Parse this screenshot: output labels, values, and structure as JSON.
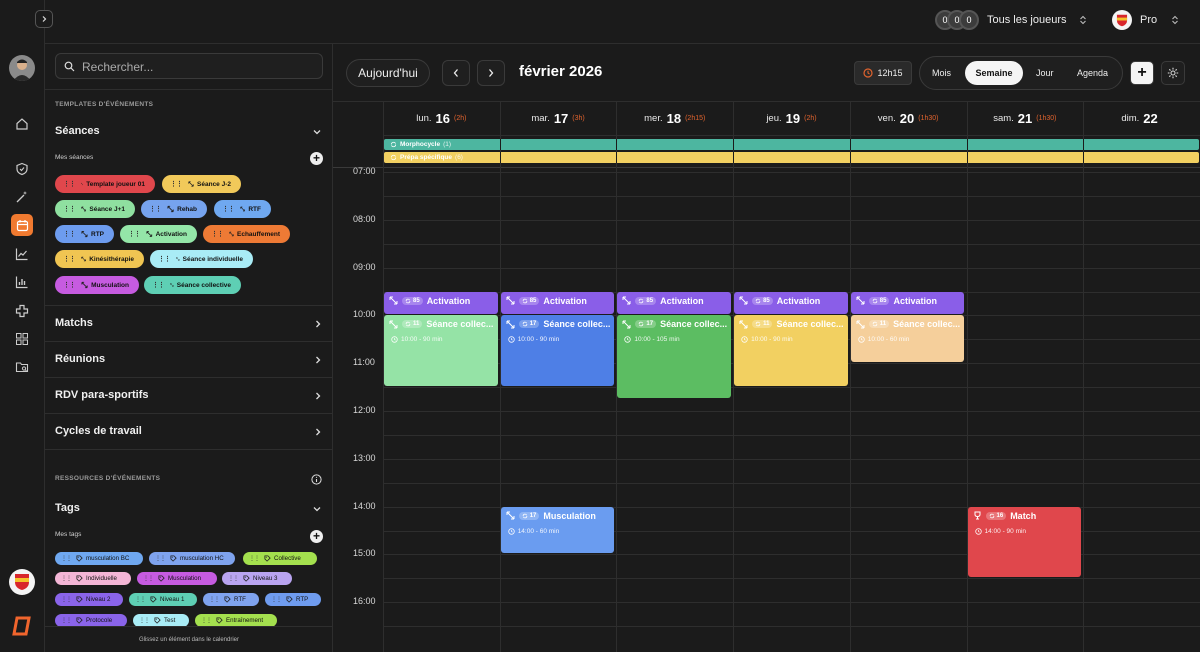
{
  "topbar": {
    "players_label": "Tous les joueurs",
    "player_avatars": [
      "0",
      "0",
      "0"
    ],
    "team_label": "Pro"
  },
  "sidebar": {
    "search_placeholder": "Rechercher...",
    "templates_heading": "TEMPLATES D'ÉVÉNEMENTS",
    "seances": {
      "title": "Séances",
      "subtitle": "Mes séances",
      "chips": [
        {
          "label": "Template joueur 01",
          "color": "#e0474c"
        },
        {
          "label": "Séance J-2",
          "color": "#f1c95a"
        },
        {
          "label": "Séance J+1",
          "color": "#8fe0a0"
        },
        {
          "label": "Rehab",
          "color": "#76a3ee"
        },
        {
          "label": "RTF",
          "color": "#6fa8f0"
        },
        {
          "label": "RTP",
          "color": "#6d9cef"
        },
        {
          "label": "Activation",
          "color": "#94e6a8"
        },
        {
          "label": "Echauffement",
          "color": "#ee7a35"
        },
        {
          "label": "Kinésithérapie",
          "color": "#f0c552"
        },
        {
          "label": "Séance individuelle",
          "color": "#a9ecf6"
        },
        {
          "label": "Musculation",
          "color": "#c65be0"
        },
        {
          "label": "Séance collective",
          "color": "#5ecfb4"
        }
      ]
    },
    "sections": [
      "Matchs",
      "Réunions",
      "RDV para-sportifs",
      "Cycles de travail"
    ],
    "resources_heading": "RESSOURCES D'ÉVÉNEMENTS",
    "tags": {
      "title": "Tags",
      "subtitle": "Mes tags",
      "items": [
        {
          "label": "musculation BC",
          "color": "#6fa8f0"
        },
        {
          "label": "musculation HC",
          "color": "#7fa3ee"
        },
        {
          "label": "Collective",
          "color": "#a4e04e"
        },
        {
          "label": "Individuelle",
          "color": "#f4b6d6"
        },
        {
          "label": "Musculation",
          "color": "#c65be0"
        },
        {
          "label": "Niveau 3",
          "color": "#b9a4f0"
        },
        {
          "label": "Niveau 2",
          "color": "#8a64ea"
        },
        {
          "label": "Niveau 1",
          "color": "#5ecfb4"
        },
        {
          "label": "RTF",
          "color": "#7fa3ee"
        },
        {
          "label": "RTP",
          "color": "#6f9cef"
        },
        {
          "label": "Protocole",
          "color": "#8a64ea"
        },
        {
          "label": "Test",
          "color": "#a9ecf6"
        },
        {
          "label": "Entraînement",
          "color": "#a4e04e"
        }
      ]
    },
    "footer_hint": "Glissez un élément dans le calendrier"
  },
  "main": {
    "today_button": "Aujourd'hui",
    "month_title": "février 2026",
    "duration_badge": "12h15",
    "views": [
      "Mois",
      "Semaine",
      "Jour",
      "Agenda"
    ],
    "active_view": "Semaine",
    "days": [
      {
        "name": "lun.",
        "num": "16",
        "dur": "(2h)"
      },
      {
        "name": "mar.",
        "num": "17",
        "dur": "(3h)"
      },
      {
        "name": "mer.",
        "num": "18",
        "dur": "(2h15)"
      },
      {
        "name": "jeu.",
        "num": "19",
        "dur": "(2h)"
      },
      {
        "name": "ven.",
        "num": "20",
        "dur": "(1h30)"
      },
      {
        "name": "sam.",
        "num": "21",
        "dur": "(1h30)"
      },
      {
        "name": "dim.",
        "num": "22",
        "dur": ""
      }
    ],
    "allday": [
      {
        "label": "Morphocycle",
        "count": "(1)",
        "color": "#4db6a0"
      },
      {
        "label": "Prépa spécifique",
        "count": "(6)",
        "color": "#f2d061"
      }
    ],
    "hours": [
      "07:00",
      "08:00",
      "09:00",
      "10:00",
      "11:00",
      "12:00",
      "13:00",
      "14:00",
      "15:00",
      "16:00"
    ],
    "events": [
      {
        "day": 0,
        "start": 9.5,
        "end": 10.0,
        "title": "Activation",
        "count": "85",
        "sub": "",
        "color": "#8a5ee8"
      },
      {
        "day": 1,
        "start": 9.5,
        "end": 10.0,
        "title": "Activation",
        "count": "85",
        "sub": "",
        "color": "#8a5ee8"
      },
      {
        "day": 2,
        "start": 9.5,
        "end": 10.0,
        "title": "Activation",
        "count": "85",
        "sub": "",
        "color": "#8a5ee8"
      },
      {
        "day": 3,
        "start": 9.5,
        "end": 10.0,
        "title": "Activation",
        "count": "85",
        "sub": "",
        "color": "#8a5ee8"
      },
      {
        "day": 4,
        "start": 9.5,
        "end": 10.0,
        "title": "Activation",
        "count": "85",
        "sub": "",
        "color": "#8a5ee8"
      },
      {
        "day": 0,
        "start": 10.0,
        "end": 11.5,
        "title": "Séance collec...",
        "count": "11",
        "sub": "10:00 - 90 min",
        "color": "#95e3a6"
      },
      {
        "day": 1,
        "start": 10.0,
        "end": 11.5,
        "title": "Séance collec...",
        "count": "17",
        "sub": "10:00 - 90 min",
        "color": "#4e7fe6"
      },
      {
        "day": 2,
        "start": 10.0,
        "end": 11.75,
        "title": "Séance collec...",
        "count": "17",
        "sub": "10:00 - 105 min",
        "color": "#5cbd62"
      },
      {
        "day": 3,
        "start": 10.0,
        "end": 11.5,
        "title": "Séance collec...",
        "count": "11",
        "sub": "10:00 - 90 min",
        "color": "#f2d061"
      },
      {
        "day": 4,
        "start": 10.0,
        "end": 11.0,
        "title": "Séance collec...",
        "count": "11",
        "sub": "10:00 - 60 min",
        "color": "#f5cf9b"
      },
      {
        "day": 1,
        "start": 14.0,
        "end": 15.0,
        "title": "Musculation",
        "count": "17",
        "sub": "14:00 - 60 min",
        "color": "#6a9cf0"
      },
      {
        "day": 5,
        "start": 14.0,
        "end": 15.5,
        "title": "Match",
        "count": "16",
        "sub": "14:00 - 90 min",
        "color": "#e0474c"
      }
    ]
  },
  "colors": {
    "accent": "#e0632e",
    "rail_active": "#f07a30"
  }
}
